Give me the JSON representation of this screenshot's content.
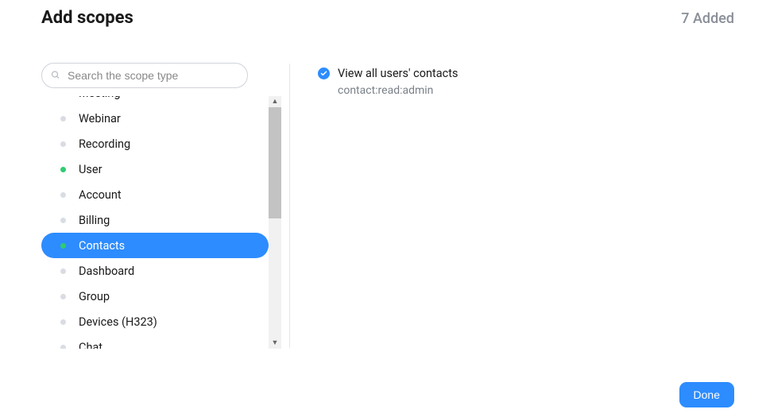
{
  "header": {
    "title": "Add scopes",
    "added_label": "7 Added"
  },
  "search": {
    "placeholder": "Search the scope type",
    "value": ""
  },
  "sidebar": {
    "items": [
      {
        "label": "Meeting",
        "has_scopes": true,
        "active": false,
        "partial": true
      },
      {
        "label": "Webinar",
        "has_scopes": false,
        "active": false,
        "partial": false
      },
      {
        "label": "Recording",
        "has_scopes": false,
        "active": false,
        "partial": false
      },
      {
        "label": "User",
        "has_scopes": true,
        "active": false,
        "partial": false
      },
      {
        "label": "Account",
        "has_scopes": false,
        "active": false,
        "partial": false
      },
      {
        "label": "Billing",
        "has_scopes": false,
        "active": false,
        "partial": false
      },
      {
        "label": "Contacts",
        "has_scopes": true,
        "active": true,
        "partial": false
      },
      {
        "label": "Dashboard",
        "has_scopes": false,
        "active": false,
        "partial": false
      },
      {
        "label": "Group",
        "has_scopes": false,
        "active": false,
        "partial": false
      },
      {
        "label": "Devices (H323)",
        "has_scopes": false,
        "active": false,
        "partial": false
      },
      {
        "label": "Chat",
        "has_scopes": false,
        "active": false,
        "partial": false
      }
    ]
  },
  "detail": {
    "items": [
      {
        "checked": true,
        "title": "View all users' contacts",
        "scope": "contact:read:admin"
      }
    ]
  },
  "footer": {
    "done_label": "Done"
  }
}
